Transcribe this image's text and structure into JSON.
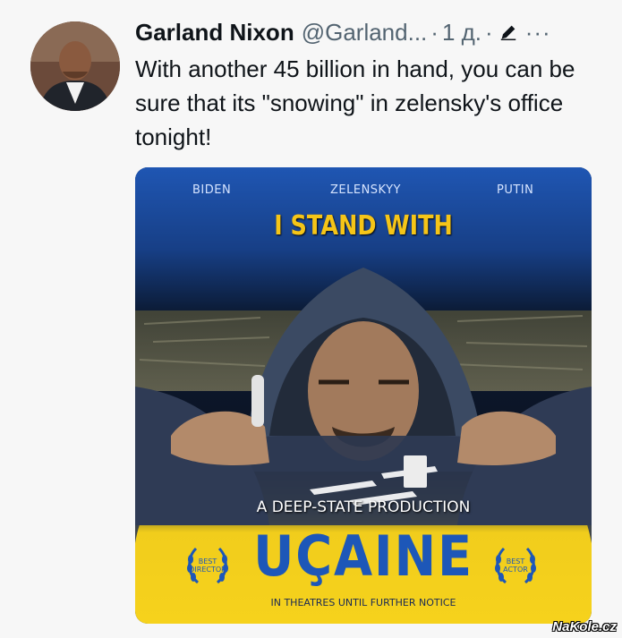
{
  "tweet": {
    "author_name": "Garland Nixon",
    "author_handle": "@Garland...",
    "separator": "·",
    "time": "1 д.",
    "more_glyph": "···",
    "text": "With another 45 billion in hand, you can be sure that its \"snowing\" in zelensky's office tonight!"
  },
  "poster": {
    "cast": [
      "BIDEN",
      "ZELENSKYY",
      "PUTIN"
    ],
    "tagline": "I STAND WITH",
    "production": "A DEEP-STATE PRODUCTION",
    "title": "UÇAINE",
    "release": "IN THEATRES UNTIL FURTHER NOTICE",
    "award_left": [
      "BEST",
      "DIRECTOR"
    ],
    "award_right": [
      "BEST",
      "ACTOR"
    ],
    "colors": {
      "blue": "#1d57b8",
      "yellow": "#f6d21c",
      "gold": "#f5c518"
    }
  },
  "watermark": "NaKole.cz",
  "icons": {
    "edit": "pencil-icon",
    "more": "more-options-icon"
  }
}
